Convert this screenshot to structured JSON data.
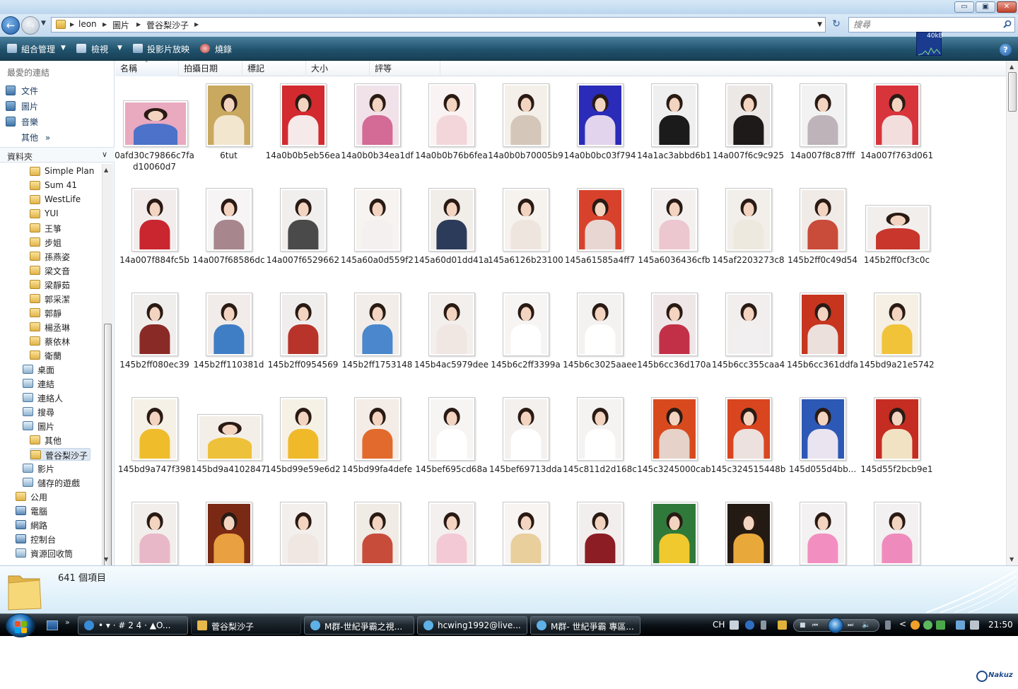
{
  "window": {
    "title_buttons": {
      "minimize": "▭",
      "maximize": "▣",
      "close": "✕"
    }
  },
  "address": {
    "breadcrumbs": [
      "leon",
      "圖片",
      "菅谷梨沙子"
    ],
    "search_placeholder": "搜尋"
  },
  "toolbar": {
    "organize": "組合管理",
    "views": "檢視",
    "slideshow": "投影片放映",
    "burn": "燒錄",
    "net_graph_label": "40kB"
  },
  "nav": {
    "favorites_title": "最愛的連結",
    "favorites": [
      "文件",
      "圖片",
      "音樂"
    ],
    "more": "其他",
    "more_chevron": "»",
    "folders_title": "資料夾",
    "tree": [
      {
        "label": "Simple Plan",
        "indent": 2,
        "icon": "folder"
      },
      {
        "label": "Sum 41",
        "indent": 2,
        "icon": "folder"
      },
      {
        "label": "WestLife",
        "indent": 2,
        "icon": "folder"
      },
      {
        "label": "YUI",
        "indent": 2,
        "icon": "folder"
      },
      {
        "label": "王箏",
        "indent": 2,
        "icon": "folder"
      },
      {
        "label": "步姐",
        "indent": 2,
        "icon": "folder"
      },
      {
        "label": "孫燕姿",
        "indent": 2,
        "icon": "folder"
      },
      {
        "label": "梁文音",
        "indent": 2,
        "icon": "folder"
      },
      {
        "label": "梁靜茹",
        "indent": 2,
        "icon": "folder"
      },
      {
        "label": "郭采潔",
        "indent": 2,
        "icon": "folder"
      },
      {
        "label": "郭靜",
        "indent": 2,
        "icon": "folder"
      },
      {
        "label": "楊丞琳",
        "indent": 2,
        "icon": "folder"
      },
      {
        "label": "蔡依林",
        "indent": 2,
        "icon": "folder"
      },
      {
        "label": "衛蘭",
        "indent": 2,
        "icon": "folder"
      },
      {
        "label": "桌面",
        "indent": 1,
        "icon": "special"
      },
      {
        "label": "連結",
        "indent": 1,
        "icon": "special"
      },
      {
        "label": "連絡人",
        "indent": 1,
        "icon": "special"
      },
      {
        "label": "搜尋",
        "indent": 1,
        "icon": "special"
      },
      {
        "label": "圖片",
        "indent": 1,
        "icon": "special"
      },
      {
        "label": "其他",
        "indent": 2,
        "icon": "folder"
      },
      {
        "label": "菅谷梨沙子",
        "indent": 2,
        "icon": "folder",
        "selected": true
      },
      {
        "label": "影片",
        "indent": 1,
        "icon": "special"
      },
      {
        "label": "儲存的遊戲",
        "indent": 1,
        "icon": "special"
      },
      {
        "label": "公用",
        "indent": 0,
        "icon": "folder"
      },
      {
        "label": "電腦",
        "indent": 0,
        "icon": "pc"
      },
      {
        "label": "網路",
        "indent": 0,
        "icon": "pc"
      },
      {
        "label": "控制台",
        "indent": 0,
        "icon": "pc"
      },
      {
        "label": "資源回收筒",
        "indent": 0,
        "icon": "special"
      }
    ]
  },
  "columns": [
    "名稱",
    "拍攝日期",
    "標記",
    "大小",
    "評等"
  ],
  "files": [
    {
      "name": "0afd30c79866c7fad10060d7",
      "bg": "#e9a9bf",
      "top": "#4c72c9",
      "wide": true
    },
    {
      "name": "6tut",
      "bg": "#c9a85f",
      "top": "#f2e6cf"
    },
    {
      "name": "14a0b0b5eb56ea",
      "bg": "#d22a2f",
      "top": "#f5e9ea"
    },
    {
      "name": "14a0b0b34ea1df",
      "bg": "#f1e2ea",
      "top": "#d46a96"
    },
    {
      "name": "14a0b0b76b6fea",
      "bg": "#faf3f3",
      "top": "#f2d6da"
    },
    {
      "name": "14a0b0b70005b9",
      "bg": "#f4efe9",
      "top": "#d4c6b8"
    },
    {
      "name": "14a0b0bc03f794",
      "bg": "#2a2bb8",
      "top": "#e2d4ec"
    },
    {
      "name": "14a1ac3abbd6b1",
      "bg": "#efefef",
      "top": "#1b1b1b"
    },
    {
      "name": "14a007f6c9c925",
      "bg": "#ece8e6",
      "top": "#1e1a1a"
    },
    {
      "name": "14a007f8c87fff",
      "bg": "#f2f2f2",
      "top": "#bdb3b8"
    },
    {
      "name": "14a007f763d061",
      "bg": "#d8343b",
      "top": "#f3dede"
    },
    {
      "name": "14a007f884fc5b",
      "bg": "#f2ecec",
      "top": "#c9262f"
    },
    {
      "name": "14a007f68586dc",
      "bg": "#f6f4f4",
      "top": "#a8868e"
    },
    {
      "name": "14a007f6529662",
      "bg": "#f1eeee",
      "top": "#4a4a4a"
    },
    {
      "name": "145a60a0d559f2",
      "bg": "#f6f3f0",
      "top": "#f3f0ef"
    },
    {
      "name": "145a60d01dd41a",
      "bg": "#f1ede9",
      "top": "#2d3b5a"
    },
    {
      "name": "145a6126b23100",
      "bg": "#f6f2ee",
      "top": "#efe5df"
    },
    {
      "name": "145a61585a4ff7",
      "bg": "#d8422c",
      "top": "#e8d6d2"
    },
    {
      "name": "145a6036436cfb",
      "bg": "#f4f0f0",
      "top": "#ecc7cf"
    },
    {
      "name": "145af2203273c8",
      "bg": "#f2eee9",
      "top": "#eee9df"
    },
    {
      "name": "145b2ff0c49d54",
      "bg": "#f1ebe7",
      "top": "#c94b3a"
    },
    {
      "name": "145b2ff0cf3c0c",
      "bg": "#f2eeec",
      "top": "#c8362c",
      "wide": true
    },
    {
      "name": "145b2ff080ec39",
      "bg": "#efeeed",
      "top": "#8a2a26"
    },
    {
      "name": "145b2ff110381d",
      "bg": "#f1ece9",
      "top": "#3f7ec5"
    },
    {
      "name": "145b2ff0954569",
      "bg": "#f0eeed",
      "top": "#b8342b"
    },
    {
      "name": "145b2ff1753148",
      "bg": "#f2ede9",
      "top": "#4a87cc"
    },
    {
      "name": "145b4ac5979dee",
      "bg": "#f3efed",
      "top": "#f0e6e2"
    },
    {
      "name": "145b6c2ff3399a",
      "bg": "#f7f5f4",
      "top": "#ffffff"
    },
    {
      "name": "145b6c3025aaee",
      "bg": "#f4f2f1",
      "top": "#ffffff"
    },
    {
      "name": "145b6cc36d170a",
      "bg": "#efe7e7",
      "top": "#c23048"
    },
    {
      "name": "145b6cc355caa4",
      "bg": "#f2eeee",
      "top": "#f1eff0"
    },
    {
      "name": "145b6cc361ddfa",
      "bg": "#c7351f",
      "top": "#ece0dc"
    },
    {
      "name": "145bd9a21e5742",
      "bg": "#f5efe4",
      "top": "#f0c339"
    },
    {
      "name": "145bd9a747f398",
      "bg": "#f6f1e7",
      "top": "#efbd2b"
    },
    {
      "name": "145bd9a4102847",
      "bg": "#f3efe8",
      "top": "#eec13a",
      "wide": true
    },
    {
      "name": "145bd99e59e6d2",
      "bg": "#f6f1e5",
      "top": "#efb929"
    },
    {
      "name": "145bd99fa4defe",
      "bg": "#f4ece6",
      "top": "#e26a2c"
    },
    {
      "name": "145bef695cd68a",
      "bg": "#f6f5f4",
      "top": "#ffffff"
    },
    {
      "name": "145bef69713dda",
      "bg": "#f3f0ee",
      "top": "#ffffff"
    },
    {
      "name": "145c811d2d168c",
      "bg": "#f4f3f2",
      "top": "#ffffff"
    },
    {
      "name": "145c3245000cab",
      "bg": "#d84a1e",
      "top": "#e6d2c8"
    },
    {
      "name": "145c324515448b",
      "bg": "#d9451f",
      "top": "#ece1de"
    },
    {
      "name": "145d055d4bb...",
      "bg": "#2d59b6",
      "top": "#e9e4f0"
    },
    {
      "name": "145d55f2bcb9e1",
      "bg": "#c52d22",
      "top": "#f2e2c4"
    },
    {
      "name": "",
      "bg": "#f2eeec",
      "top": "#e9b8c8"
    },
    {
      "name": "",
      "bg": "#7a2a14",
      "top": "#e9a040"
    },
    {
      "name": "",
      "bg": "#f3efed",
      "top": "#f0e7e3"
    },
    {
      "name": "",
      "bg": "#f1ebe6",
      "top": "#c84c3a"
    },
    {
      "name": "",
      "bg": "#f4f0ef",
      "top": "#f3c9d6"
    },
    {
      "name": "",
      "bg": "#f7f4f2",
      "top": "#e9cf9c"
    },
    {
      "name": "",
      "bg": "#f2eeed",
      "top": "#8c1d24"
    },
    {
      "name": "",
      "bg": "#2f7a3a",
      "top": "#f0c92e"
    },
    {
      "name": "",
      "bg": "#241a14",
      "top": "#e9a83a"
    },
    {
      "name": "",
      "bg": "#f4f1f2",
      "top": "#f28fc0"
    },
    {
      "name": "",
      "bg": "#f3f0f1",
      "top": "#ef8bbc"
    }
  ],
  "details": {
    "count": "641 個項目"
  },
  "taskbar": {
    "quicklaunch_more": "»",
    "tasks": [
      {
        "label": "• ▾ · # 2 4 · ▲O...",
        "icon": "ie-icon",
        "color": "#3a8bd6"
      },
      {
        "label": "菅谷梨沙子",
        "icon": "folder-icon",
        "color": "#e6b84a",
        "active": true
      },
      {
        "label": "M群-世紀爭霸之視...",
        "icon": "msn-icon",
        "color": "#5fb0e6"
      },
      {
        "label": "hcwing1992@live...",
        "icon": "msn-icon",
        "color": "#5fb0e6"
      },
      {
        "label": "M群- 世紀爭霸 專區...",
        "icon": "msn-icon",
        "color": "#5fb0e6"
      }
    ],
    "language": "CH",
    "clock": "21:50"
  },
  "watermark": "Nakuz"
}
